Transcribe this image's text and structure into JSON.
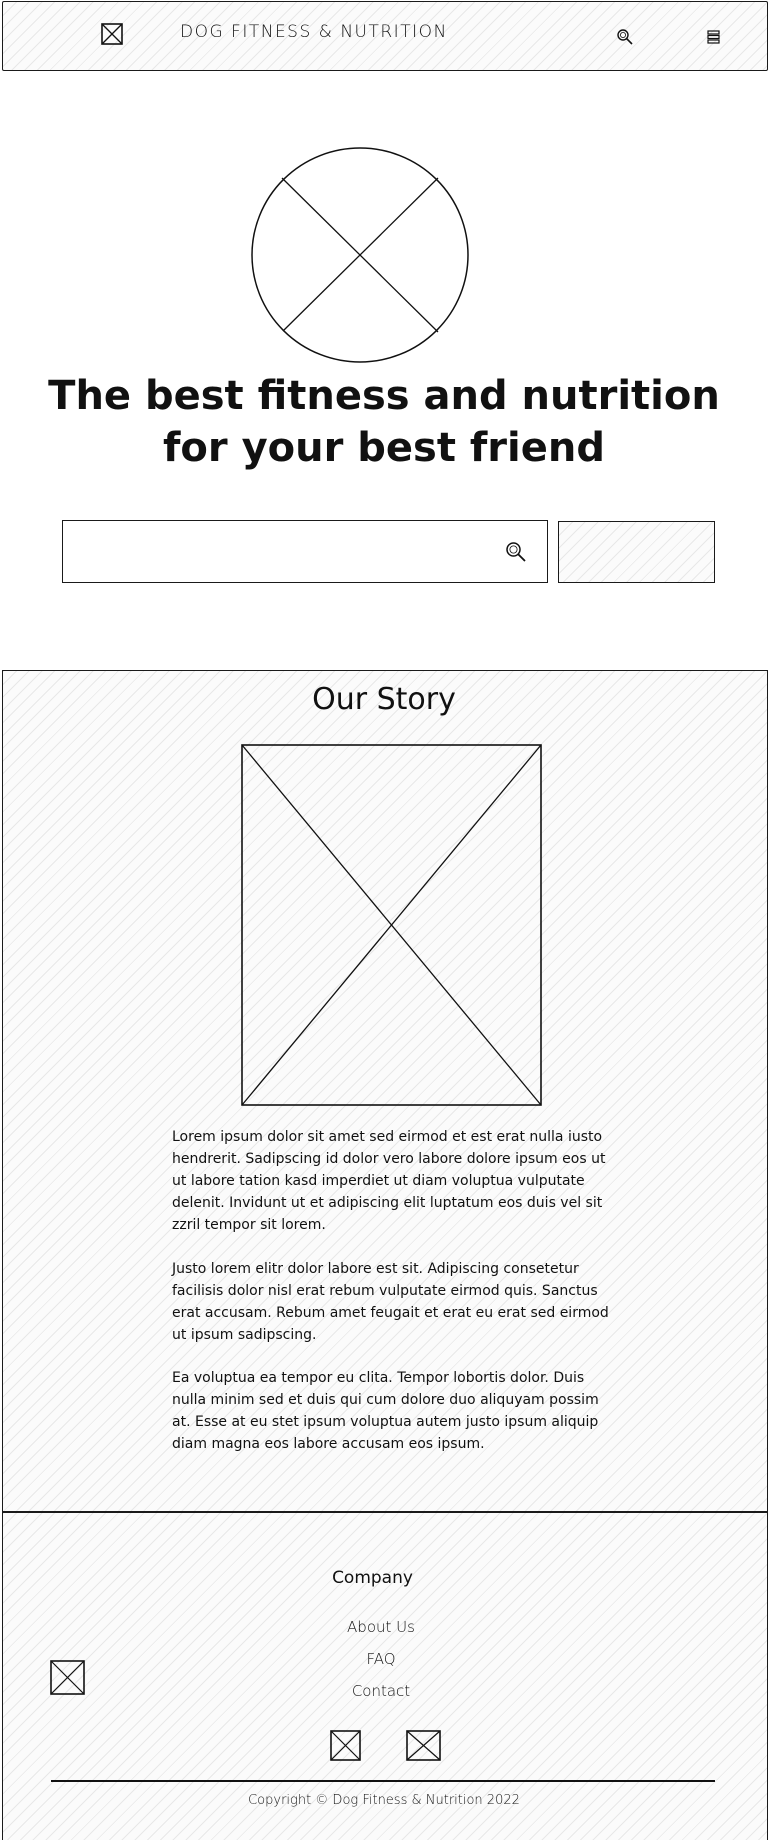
{
  "header": {
    "title": "DOG FITNESS & NUTRITION",
    "logo_icon": "image-placeholder-icon",
    "search_icon": "search-icon",
    "menu_icon": "hamburger-menu-icon"
  },
  "hero": {
    "title": "The best fitness and nutrition for your best friend",
    "image_icon": "image-placeholder-icon",
    "search": {
      "value": "",
      "placeholder": "",
      "icon": "search-icon"
    },
    "button_label": ""
  },
  "story": {
    "title": "Our Story",
    "image_icon": "image-placeholder-icon",
    "paragraphs": [
      "Lorem ipsum dolor sit amet sed eirmod et est erat nulla iusto hendrerit. Sadipscing id dolor vero labore dolore ipsum eos ut ut labore tation kasd imperdiet ut diam voluptua vulputate delenit. Invidunt ut et adipiscing elit luptatum eos duis vel sit zzril tempor sit lorem.",
      "Justo lorem elitr dolor labore est sit. Adipiscing consetetur facilisis dolor nisl erat rebum vulputate eirmod quis. Sanctus erat accusam. Rebum amet feugait et erat eu erat sed eirmod ut ipsum sadipscing.",
      "Ea voluptua ea tempor eu clita. Tempor lobortis dolor. Duis nulla minim sed et duis qui cum dolore duo aliquyam possim at. Esse at eu stet ipsum voluptua autem justo ipsum aliquip diam magna eos labore accusam eos ipsum."
    ]
  },
  "footer": {
    "heading": "Company",
    "links": [
      "About Us",
      "FAQ",
      "Contact"
    ],
    "logo_icon": "image-placeholder-icon",
    "social_icons": [
      "image-placeholder-icon",
      "image-placeholder-icon"
    ],
    "copyright": "Copyright © Dog Fitness & Nutrition 2022"
  }
}
